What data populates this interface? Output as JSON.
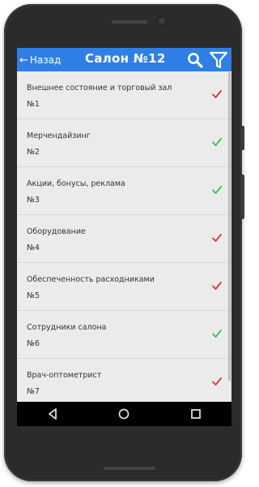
{
  "header": {
    "back_label": "Назад",
    "title": "Салон  №12",
    "color": "#2f7fe6"
  },
  "icons": {
    "back": "arrow-left-icon",
    "search": "search-icon",
    "filter": "filter-icon",
    "nav": [
      "back-triangle-icon",
      "home-circle-icon",
      "recents-square-icon"
    ]
  },
  "status_colors": {
    "done": "#3fbf4a",
    "todo": "#d9343a"
  },
  "items": [
    {
      "name": "Внешнее состояние и торговый зал",
      "num": "№1",
      "status": "todo"
    },
    {
      "name": "Мерчендайзинг",
      "num": "№2",
      "status": "done"
    },
    {
      "name": "Акции, бонусы, реклама",
      "num": "№3",
      "status": "done"
    },
    {
      "name": "Оборудование",
      "num": "№4",
      "status": "todo"
    },
    {
      "name": "Обеспеченность расходниками",
      "num": "№5",
      "status": "todo"
    },
    {
      "name": "Сотрудники салона",
      "num": "№6",
      "status": "done"
    },
    {
      "name": "Врач-оптометрист",
      "num": "№7",
      "status": "todo"
    }
  ]
}
